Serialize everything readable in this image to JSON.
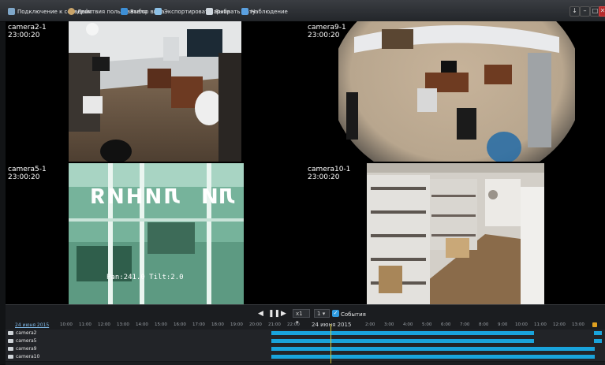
{
  "toolbar": {
    "items": [
      {
        "label": "Подключение к серверам",
        "icon": "servers-icon"
      },
      {
        "label": "Действия пользователя",
        "icon": "user-icon"
      },
      {
        "label": "Выбор вида",
        "icon": "layout-grid-icon"
      },
      {
        "label": "Экспортировать архив",
        "icon": "export-icon"
      },
      {
        "label": "Выбрать дату",
        "icon": "calendar-icon"
      },
      {
        "label": "Наблюдение",
        "icon": "monitor-icon"
      }
    ],
    "window_buttons": [
      "↓",
      "–",
      "□",
      "✕"
    ]
  },
  "cameras": [
    {
      "name": "camera2-1",
      "time": "23:00:20"
    },
    {
      "name": "camera9-1",
      "time": "23:00:20"
    },
    {
      "name": "camera5-1",
      "time": "23:00:20"
    },
    {
      "name": "camera10-1",
      "time": "23:00:20"
    }
  ],
  "overlay_texts": {
    "camera5_sign": "ЛИНИЯ",
    "camera5_sign2": "ЛИ",
    "camera5_ptz": "Pan:241.0 Tilt:2.0"
  },
  "playback": {
    "speed": "x1",
    "step": "1",
    "events_label": "События",
    "events_checked": true
  },
  "timeline": {
    "date_link": "24 июня 2015",
    "center_date": "24 июня 2015",
    "ticks_before": [
      "10:00",
      "11:00",
      "12:00",
      "13:00",
      "14:00",
      "15:00",
      "16:00",
      "17:00",
      "18:00",
      "19:00",
      "20:00",
      "21:00",
      "22:00"
    ],
    "ticks_after": [
      "2:00",
      "3:00",
      "4:00",
      "5:00",
      "6:00",
      "7:00",
      "8:00",
      "9:00",
      "10:00",
      "11:00",
      "12:00",
      "13:00"
    ],
    "rows": [
      {
        "name": "camera2"
      },
      {
        "name": "camera5"
      },
      {
        "name": "camera9"
      },
      {
        "name": "camera10"
      }
    ]
  },
  "colors": {
    "accent": "#19a3db",
    "now_marker": "#d6c43a",
    "background": "#121416"
  }
}
